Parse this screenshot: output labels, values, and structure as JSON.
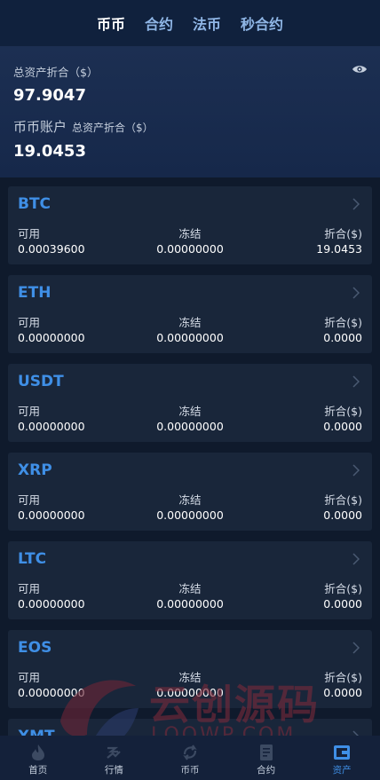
{
  "top_tabs": [
    {
      "label": "币币",
      "active": true
    },
    {
      "label": "合约",
      "active": false
    },
    {
      "label": "法币",
      "active": false
    },
    {
      "label": "秒合约",
      "active": false
    }
  ],
  "summary": {
    "total_label": "总资产折合（$）",
    "total_value": "97.9047",
    "account_label": "币币账户",
    "account_sub_label": "总资产折合（$）",
    "account_value": "19.0453"
  },
  "column_labels": {
    "available": "可用",
    "frozen": "冻结",
    "converted": "折合($)"
  },
  "assets": [
    {
      "coin": "BTC",
      "available": "0.00039600",
      "frozen": "0.00000000",
      "converted": "19.0453"
    },
    {
      "coin": "ETH",
      "available": "0.00000000",
      "frozen": "0.00000000",
      "converted": "0.0000"
    },
    {
      "coin": "USDT",
      "available": "0.00000000",
      "frozen": "0.00000000",
      "converted": "0.0000"
    },
    {
      "coin": "XRP",
      "available": "0.00000000",
      "frozen": "0.00000000",
      "converted": "0.0000"
    },
    {
      "coin": "LTC",
      "available": "0.00000000",
      "frozen": "0.00000000",
      "converted": "0.0000"
    },
    {
      "coin": "EOS",
      "available": "0.00000000",
      "frozen": "0.00000000",
      "converted": "0.0000"
    }
  ],
  "partial_asset": {
    "coin": "XMT"
  },
  "watermark": {
    "title": "云创源码",
    "subtitle": "LOOWP.COM"
  },
  "bottom_nav": [
    {
      "label": "首页",
      "icon": "home-icon",
      "active": false
    },
    {
      "label": "行情",
      "icon": "market-icon",
      "active": false
    },
    {
      "label": "币币",
      "icon": "exchange-icon",
      "active": false
    },
    {
      "label": "合约",
      "icon": "contract-icon",
      "active": false
    },
    {
      "label": "资产",
      "icon": "wallet-icon",
      "active": true
    }
  ],
  "colors": {
    "accent": "#3f8fe6",
    "background": "#0f1a2c",
    "card": "#19263a",
    "header": "#16284a"
  }
}
